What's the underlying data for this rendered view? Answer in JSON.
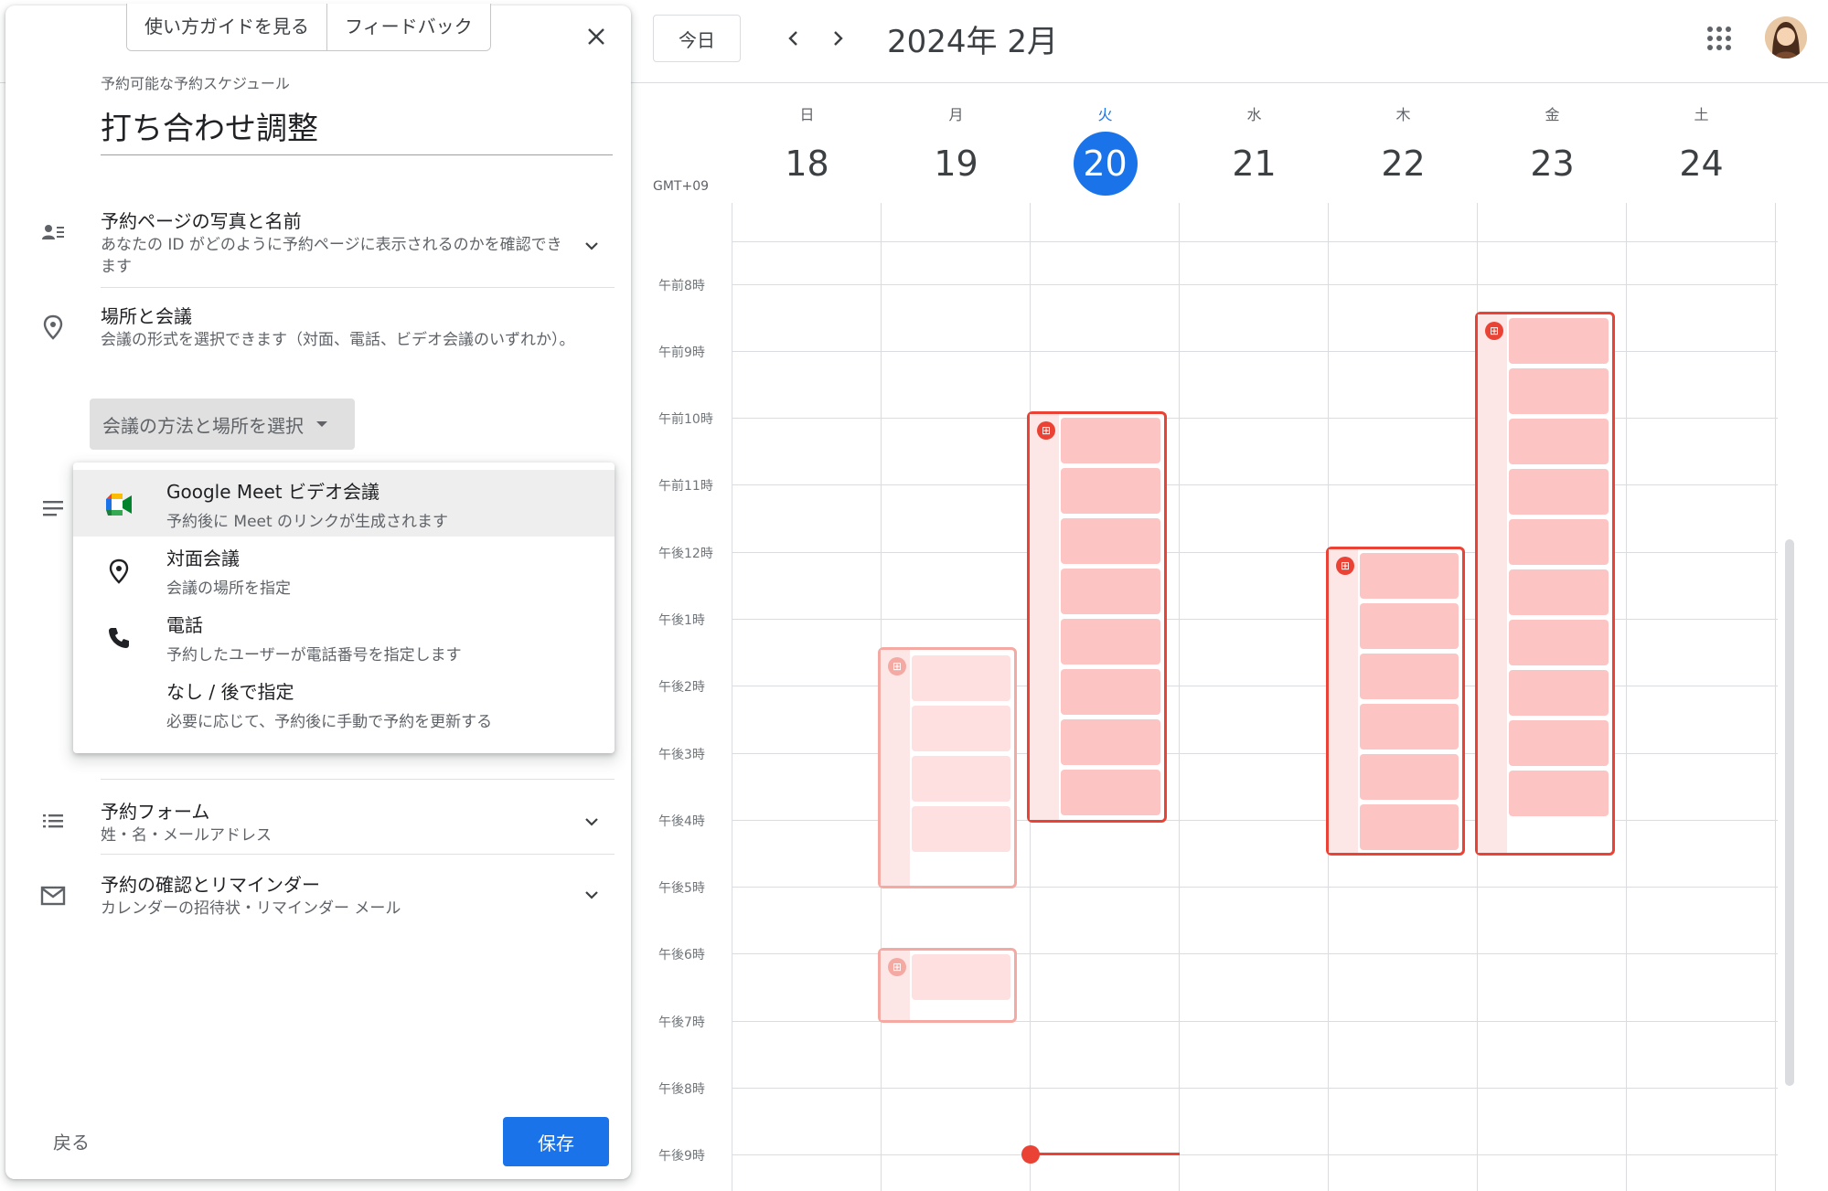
{
  "panel": {
    "guide_button": "使い方ガイドを見る",
    "feedback_button": "フィードバック",
    "subtitle": "予約可能な予約スケジュール",
    "title": "打ち合わせ調整",
    "sections": {
      "photo_name": {
        "title": "予約ページの写真と名前",
        "desc": "あなたの ID がどのように予約ページに表示されるのかを確認できます"
      },
      "location": {
        "title": "場所と会議",
        "desc": "会議の形式を選択できます（対面、電話、ビデオ会議のいずれか）。"
      },
      "booking_form": {
        "title": "予約フォーム",
        "desc": "姓・名・メールアドレス"
      },
      "confirmation": {
        "title": "予約の確認とリマインダー",
        "desc": "カレンダーの招待状・リマインダー メール"
      }
    },
    "method_select_label": "会議の方法と場所を選択",
    "dropdown": [
      {
        "title": "Google Meet ビデオ会議",
        "sub": "予約後に Meet のリンクが生成されます",
        "icon": "google-meet-icon"
      },
      {
        "title": "対面会議",
        "sub": "会議の場所を指定",
        "icon": "location-pin-icon"
      },
      {
        "title": "電話",
        "sub": "予約したユーザーが電話番号を指定します",
        "icon": "phone-icon"
      },
      {
        "title": "なし / 後で指定",
        "sub": "必要に応じて、予約後に手動で予約を更新する",
        "icon": ""
      }
    ],
    "back_button": "戻る",
    "save_button": "保存"
  },
  "calendar": {
    "today_button": "今日",
    "month_label": "2024年 2月",
    "timezone": "GMT+09",
    "days": [
      {
        "dow": "日",
        "date": "18",
        "today": false
      },
      {
        "dow": "月",
        "date": "19",
        "today": false
      },
      {
        "dow": "火",
        "date": "20",
        "today": true
      },
      {
        "dow": "水",
        "date": "21",
        "today": false
      },
      {
        "dow": "木",
        "date": "22",
        "today": false
      },
      {
        "dow": "金",
        "date": "23",
        "today": false
      },
      {
        "dow": "土",
        "date": "24",
        "today": false
      }
    ],
    "time_labels": [
      "午前8時",
      "午前9時",
      "午前10時",
      "午前11時",
      "午後12時",
      "午後1時",
      "午後2時",
      "午後3時",
      "午後4時",
      "午後5時",
      "午後6時",
      "午後7時",
      "午後8時",
      "午後9時"
    ],
    "appointment_badge": "⊞"
  },
  "colors": {
    "accent": "#1a73e8",
    "appointment_border": "#ea4335",
    "appointment_slot": "#fcc5c3",
    "appointment_slot_faded": "#fde0df"
  }
}
